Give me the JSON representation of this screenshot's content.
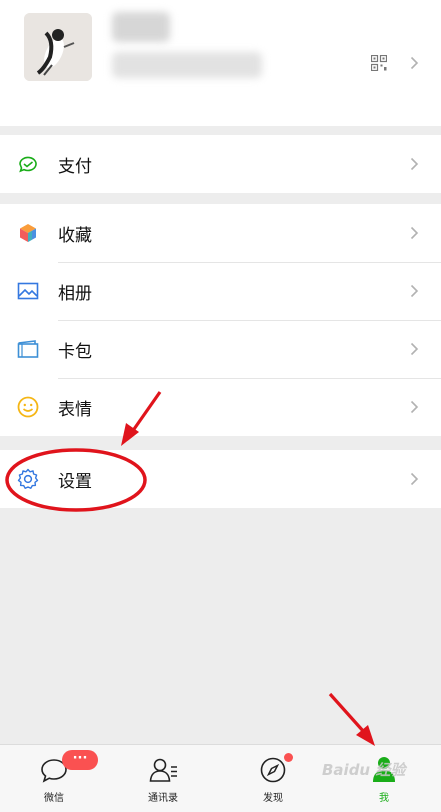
{
  "menu": {
    "pay": "支付",
    "favorites": "收藏",
    "album": "相册",
    "cards": "卡包",
    "stickers": "表情",
    "settings": "设置"
  },
  "tabbar": {
    "chats": "微信",
    "chats_badge": "···",
    "contacts": "通讯录",
    "discover": "发现",
    "me": "我"
  },
  "watermark": "Baidu 经验",
  "colors": {
    "accent_green": "#1aad19",
    "badge_red": "#fa5151",
    "annotation_red": "#e0141c",
    "page_bg": "#ededed"
  }
}
